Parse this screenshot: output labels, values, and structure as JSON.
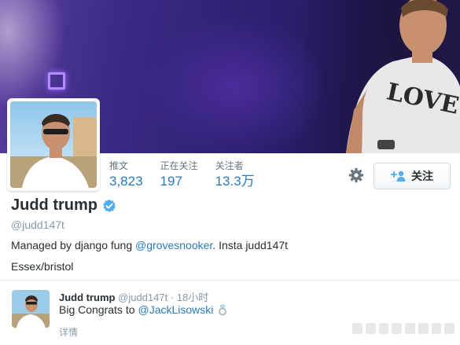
{
  "profile": {
    "name": "Judd trump",
    "handle": "@judd147t",
    "bio_prefix": "Managed by django fung ",
    "bio_mention": "@grovesnooker",
    "bio_suffix": ". Insta judd147t",
    "location": "Essex/bristol",
    "verified_icon": "verified-badge-icon"
  },
  "stats": [
    {
      "label": "推文",
      "value": "3,823"
    },
    {
      "label": "正在关注",
      "value": "197"
    },
    {
      "label": "关注者",
      "value": "13.3万"
    }
  ],
  "actions": {
    "follow_label": "关注",
    "settings_icon": "gear-icon",
    "follow_icon": "add-user-icon"
  },
  "tweet": {
    "name": "Judd trump",
    "handle": "@judd147t",
    "separator": "·",
    "time": "18小时",
    "text": "Big Congrats to",
    "mention": "@JackLisowski",
    "emoji_icon": "ring-icon",
    "details_label": "详情"
  },
  "colors": {
    "link": "#2b7bb9",
    "verified": "#55acee",
    "banner": "#2c1f70"
  }
}
